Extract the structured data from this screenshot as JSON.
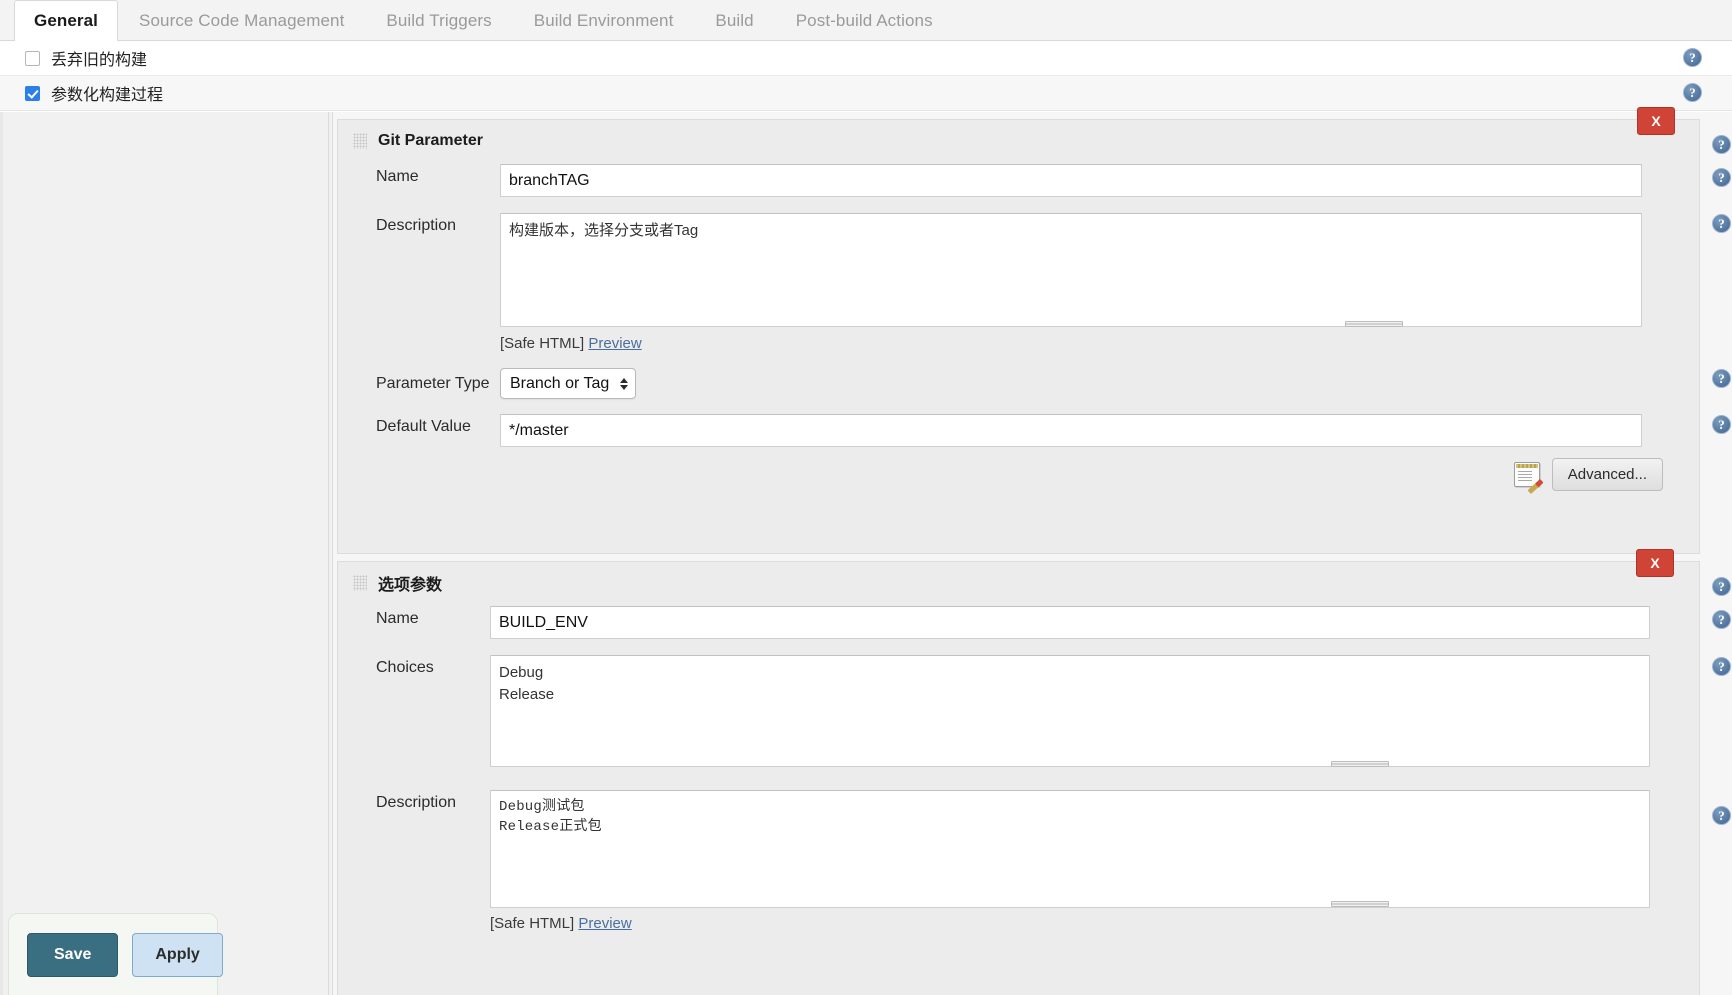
{
  "tabs": [
    {
      "label": "General",
      "active": true
    },
    {
      "label": "Source Code Management",
      "active": false
    },
    {
      "label": "Build Triggers",
      "active": false
    },
    {
      "label": "Build Environment",
      "active": false
    },
    {
      "label": "Build",
      "active": false
    },
    {
      "label": "Post-build Actions",
      "active": false
    }
  ],
  "options": {
    "discard_old_builds": {
      "label": "丢弃旧的构建",
      "checked": false
    },
    "parameterized_build": {
      "label": "参数化构建过程",
      "checked": true
    }
  },
  "git_parameter": {
    "title": "Git Parameter",
    "close_label": "X",
    "name_label": "Name",
    "name_value": "branchTAG",
    "description_label": "Description",
    "description_value": "构建版本，选择分支或者Tag",
    "safe_html_label": "[Safe HTML]",
    "preview_label": "Preview",
    "parameter_type_label": "Parameter Type",
    "parameter_type_value": "Branch or Tag",
    "default_value_label": "Default Value",
    "default_value_value": "*/master",
    "advanced_label": "Advanced..."
  },
  "choice_parameter": {
    "title": "选项参数",
    "close_label": "X",
    "name_label": "Name",
    "name_value": "BUILD_ENV",
    "choices_label": "Choices",
    "choices_value": "Debug\nRelease",
    "description_label": "Description",
    "description_value": "Debug测试包\nRelease正式包",
    "safe_html_label": "[Safe HTML]",
    "preview_label": "Preview"
  },
  "footer": {
    "save_label": "Save",
    "apply_label": "Apply"
  },
  "icons": {
    "help": "?",
    "help_name": "help-icon"
  },
  "colors": {
    "accent_blue": "#2a7fe8",
    "delete_red": "#cf4436",
    "save_teal": "#3a6f82",
    "apply_blue": "#cfe2f3",
    "help_blue": "#5a7da6",
    "link_blue": "#4a6f9e"
  }
}
